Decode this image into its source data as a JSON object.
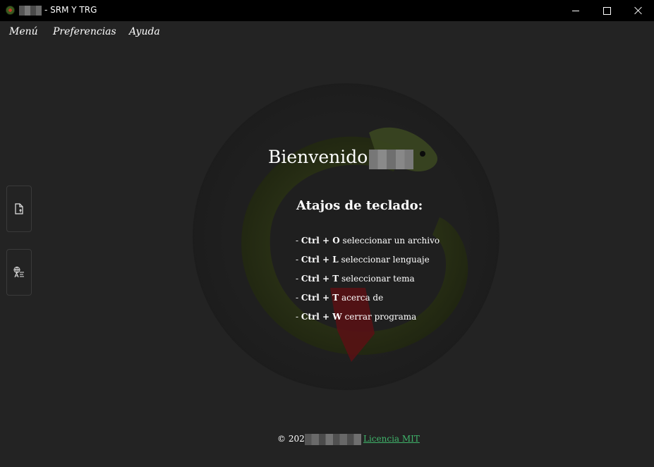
{
  "window": {
    "title": "- SRM Y TRG"
  },
  "menu": {
    "items": [
      "Menú",
      "Preferencias",
      "Ayuda"
    ]
  },
  "sidebar": {
    "buttons": [
      {
        "icon": "file-upload-icon"
      },
      {
        "icon": "translate-icon"
      }
    ]
  },
  "main": {
    "welcome": "Bienvenido a",
    "shortcuts_title": "Atajos de teclado:",
    "shortcuts": [
      {
        "prefix": "- ",
        "keys": "Ctrl + O",
        "desc": " seleccionar un archivo"
      },
      {
        "prefix": "- ",
        "keys": "Ctrl + L",
        "desc": " seleccionar lenguaje"
      },
      {
        "prefix": "- ",
        "keys": "Ctrl + T",
        "desc": " seleccionar tema"
      },
      {
        "prefix": "- ",
        "keys": "Ctrl + T",
        "desc": " acerca de"
      },
      {
        "prefix": "- ",
        "keys": "Ctrl + W",
        "desc": " cerrar programa"
      }
    ]
  },
  "footer": {
    "copyright": "© 2025",
    "license": "Licencia MIT"
  },
  "colors": {
    "background": "#232323",
    "titlebar": "#000000",
    "link": "#3fb36a"
  }
}
